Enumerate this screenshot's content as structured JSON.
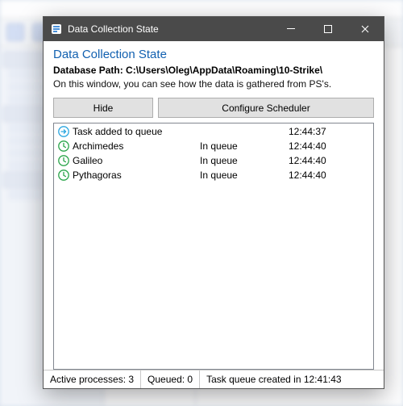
{
  "dialog": {
    "title": "Data Collection State",
    "header_title": "Data Collection State",
    "db_path_label": "Database Path: C:\\Users\\Oleg\\AppData\\Roaming\\10-Strike\\",
    "description": "On this window, you can see how the data is gathered from PS's.",
    "buttons": {
      "hide": "Hide",
      "configure": "Configure Scheduler"
    },
    "rows": [
      {
        "icon": "arrow",
        "name": "Task added to queue",
        "status": "",
        "time": "12:44:37"
      },
      {
        "icon": "clock",
        "name": "Archimedes",
        "status": "In queue",
        "time": "12:44:40"
      },
      {
        "icon": "clock",
        "name": "Galileo",
        "status": "In queue",
        "time": "12:44:40"
      },
      {
        "icon": "clock",
        "name": "Pythagoras",
        "status": "In queue",
        "time": "12:44:40"
      }
    ],
    "statusbar": {
      "active": "Active processes: 3",
      "queued": "Queued: 0",
      "task": "Task queue created in 12:41:43"
    }
  }
}
